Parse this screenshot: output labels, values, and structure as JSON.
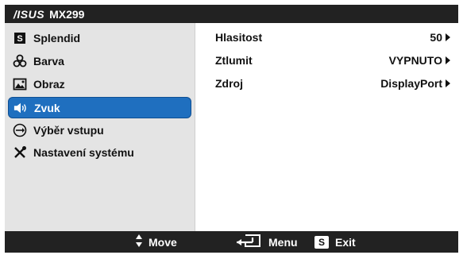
{
  "title_bar": {
    "brand_logo": "/ISUS",
    "model": "MX299"
  },
  "menu": {
    "items": [
      {
        "label": "Splendid",
        "icon": "splendid-s-icon",
        "active": false
      },
      {
        "label": "Barva",
        "icon": "color-icon",
        "active": false
      },
      {
        "label": "Obraz",
        "icon": "image-icon",
        "active": false
      },
      {
        "label": "Zvuk",
        "icon": "speaker-icon",
        "active": true
      },
      {
        "label": "Výběr vstupu",
        "icon": "input-select-icon",
        "active": false
      },
      {
        "label": "Nastavení systému",
        "icon": "tools-icon",
        "active": false
      }
    ]
  },
  "panel": {
    "rows": [
      {
        "label": "Hlasitost",
        "value": "50"
      },
      {
        "label": "Ztlumit",
        "value": "VYPNUTO"
      },
      {
        "label": "Zdroj",
        "value": "DisplayPort"
      }
    ]
  },
  "status_bar": {
    "move_label": "Move",
    "menu_label": "Menu",
    "exit_label": "Exit",
    "exit_badge": "S"
  },
  "colors": {
    "frame": "#222222",
    "menu_bg": "#e4e4e4",
    "active_bg": "#1f6fbf"
  }
}
